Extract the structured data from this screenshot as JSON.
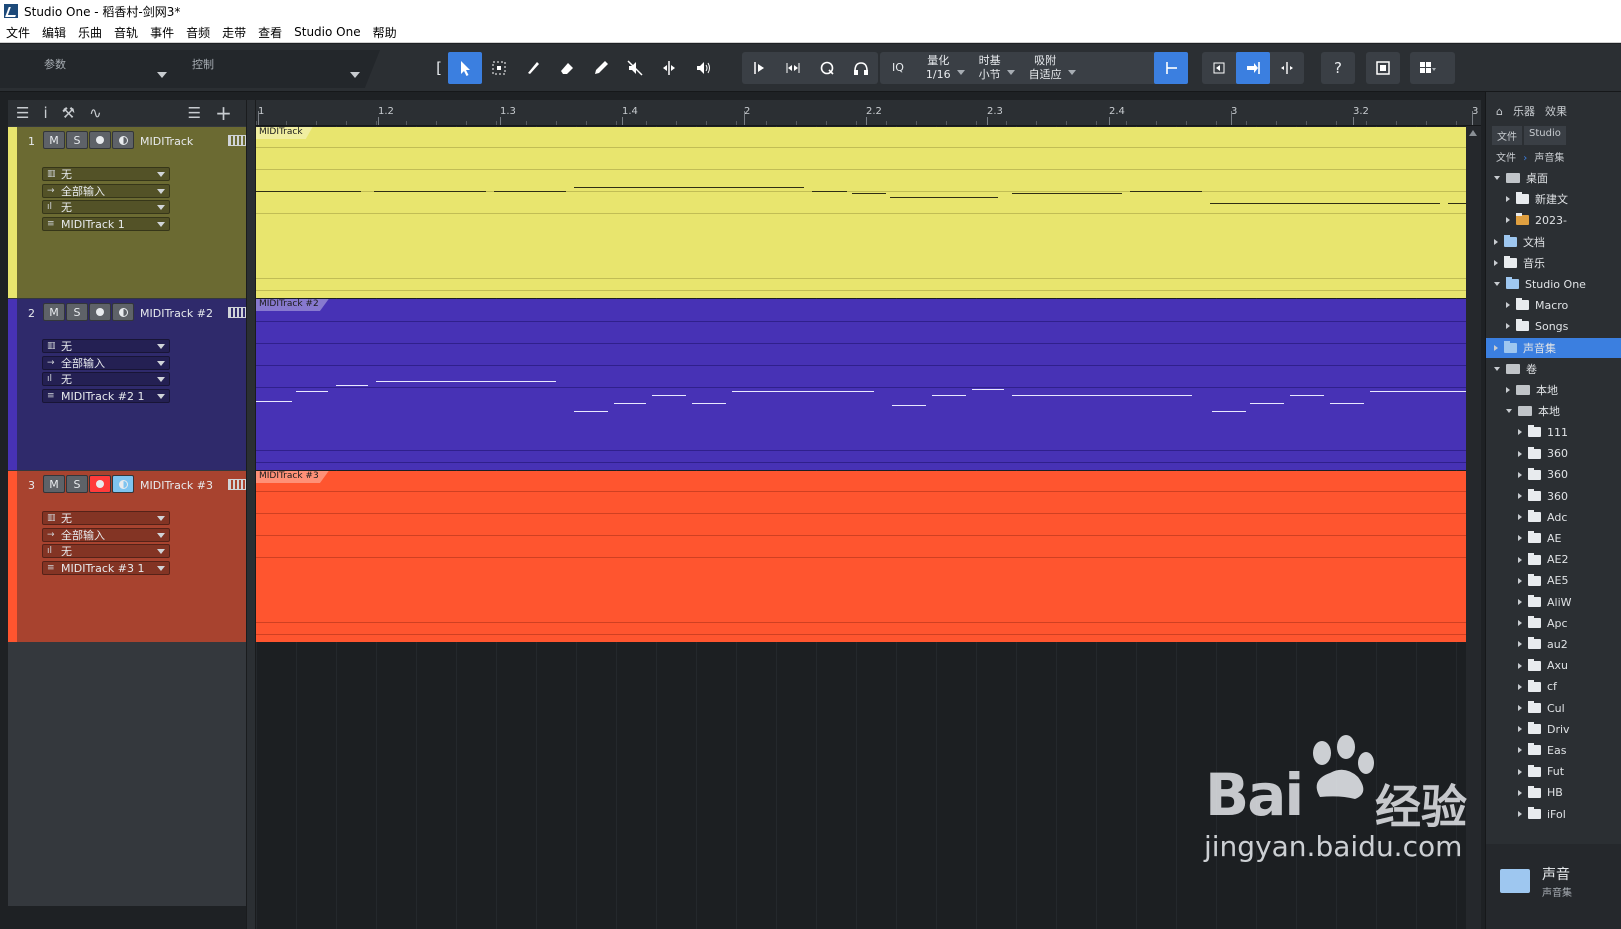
{
  "window": {
    "title": "Studio One - 稻香村-剑网3*"
  },
  "menu": [
    "文件",
    "编辑",
    "乐曲",
    "音轨",
    "事件",
    "音频",
    "走带",
    "查看",
    "Studio One",
    "帮助"
  ],
  "toolbar": {
    "param_label": "参数",
    "control_label": "控制",
    "iq_label": "IQ",
    "quantize_label": "量化",
    "quantize_value": "1/16",
    "timebase_label": "时基",
    "timebase_value": "小节",
    "snap_label": "吸附",
    "snap_value": "自适应",
    "help_label": "?"
  },
  "ruler": {
    "labels": [
      "1",
      "1.2",
      "1.3",
      "1.4",
      "2",
      "2.2",
      "2.3",
      "2.4",
      "3",
      "3.2",
      "3"
    ]
  },
  "tracks": [
    {
      "number": "1",
      "name": "MIDITrack",
      "clip": "MIDITrack",
      "color": "#e8e56e",
      "header_color": "#6b6a32",
      "strip": "#e8e56e",
      "io": [
        "无",
        "全部输入",
        "无",
        "MIDITrack 1"
      ],
      "record_armed": false,
      "monitor": false
    },
    {
      "number": "2",
      "name": "MIDITrack #2",
      "clip": "MIDITrack #2",
      "color": "#4732b5",
      "header_color": "#2f2a6b",
      "strip": "#4732b5",
      "io": [
        "无",
        "全部输入",
        "无",
        "MIDITrack #2 1"
      ],
      "record_armed": false,
      "monitor": false
    },
    {
      "number": "3",
      "name": "MIDITrack #3",
      "clip": "MIDITrack #3",
      "color": "#ff552f",
      "header_color": "#a8432f",
      "strip": "#ff552f",
      "io": [
        "无",
        "全部输入",
        "无",
        "MIDITrack #3 1"
      ],
      "record_armed": true,
      "monitor": true
    }
  ],
  "track_buttons": {
    "mute": "M",
    "solo": "S"
  },
  "browser": {
    "tabs": [
      "乐器",
      "效果"
    ],
    "subtabs": [
      "文件",
      "Studio"
    ],
    "crumbs": [
      "文件",
      "声音集"
    ],
    "tree": [
      {
        "label": "桌面",
        "indent": 0,
        "open": true,
        "kind": "drive"
      },
      {
        "label": "新建文",
        "indent": 1,
        "open": false,
        "kind": "folder"
      },
      {
        "label": "2023-",
        "indent": 1,
        "open": false,
        "kind": "file"
      },
      {
        "label": "文档",
        "indent": 0,
        "open": false,
        "kind": "blue"
      },
      {
        "label": "音乐",
        "indent": 0,
        "open": false,
        "kind": "folder"
      },
      {
        "label": "Studio One",
        "indent": 0,
        "open": true,
        "kind": "blue"
      },
      {
        "label": "Macro",
        "indent": 1,
        "open": false,
        "kind": "folder"
      },
      {
        "label": "Songs",
        "indent": 1,
        "open": false,
        "kind": "folder"
      },
      {
        "label": "声音集",
        "indent": 0,
        "open": false,
        "kind": "blue",
        "selected": true
      },
      {
        "label": "卷",
        "indent": 0,
        "open": true,
        "kind": "drive"
      },
      {
        "label": "本地",
        "indent": 1,
        "open": false,
        "kind": "drive"
      },
      {
        "label": "本地",
        "indent": 1,
        "open": true,
        "kind": "drive"
      },
      {
        "label": "111",
        "indent": 2,
        "open": false,
        "kind": "folder"
      },
      {
        "label": "360",
        "indent": 2,
        "open": false,
        "kind": "folder"
      },
      {
        "label": "360",
        "indent": 2,
        "open": false,
        "kind": "folder"
      },
      {
        "label": "360",
        "indent": 2,
        "open": false,
        "kind": "folder"
      },
      {
        "label": "Adc",
        "indent": 2,
        "open": false,
        "kind": "folder"
      },
      {
        "label": "AE",
        "indent": 2,
        "open": false,
        "kind": "folder"
      },
      {
        "label": "AE2",
        "indent": 2,
        "open": false,
        "kind": "folder"
      },
      {
        "label": "AE5",
        "indent": 2,
        "open": false,
        "kind": "folder"
      },
      {
        "label": "AliW",
        "indent": 2,
        "open": false,
        "kind": "folder"
      },
      {
        "label": "Apc",
        "indent": 2,
        "open": false,
        "kind": "folder"
      },
      {
        "label": "au2",
        "indent": 2,
        "open": false,
        "kind": "folder"
      },
      {
        "label": "Axu",
        "indent": 2,
        "open": false,
        "kind": "folder"
      },
      {
        "label": "cf",
        "indent": 2,
        "open": false,
        "kind": "folder"
      },
      {
        "label": "Cul",
        "indent": 2,
        "open": false,
        "kind": "folder"
      },
      {
        "label": "Driv",
        "indent": 2,
        "open": false,
        "kind": "folder"
      },
      {
        "label": "Eas",
        "indent": 2,
        "open": false,
        "kind": "folder"
      },
      {
        "label": "Fut",
        "indent": 2,
        "open": false,
        "kind": "folder"
      },
      {
        "label": "HB",
        "indent": 2,
        "open": false,
        "kind": "folder"
      },
      {
        "label": "iFol",
        "indent": 2,
        "open": false,
        "kind": "folder"
      }
    ],
    "bottom_title": "声音",
    "bottom_subtitle": "声音集"
  },
  "watermark": {
    "brand": "Bai",
    "brand_cn": "经验",
    "url": "jingyan.baidu.com"
  }
}
